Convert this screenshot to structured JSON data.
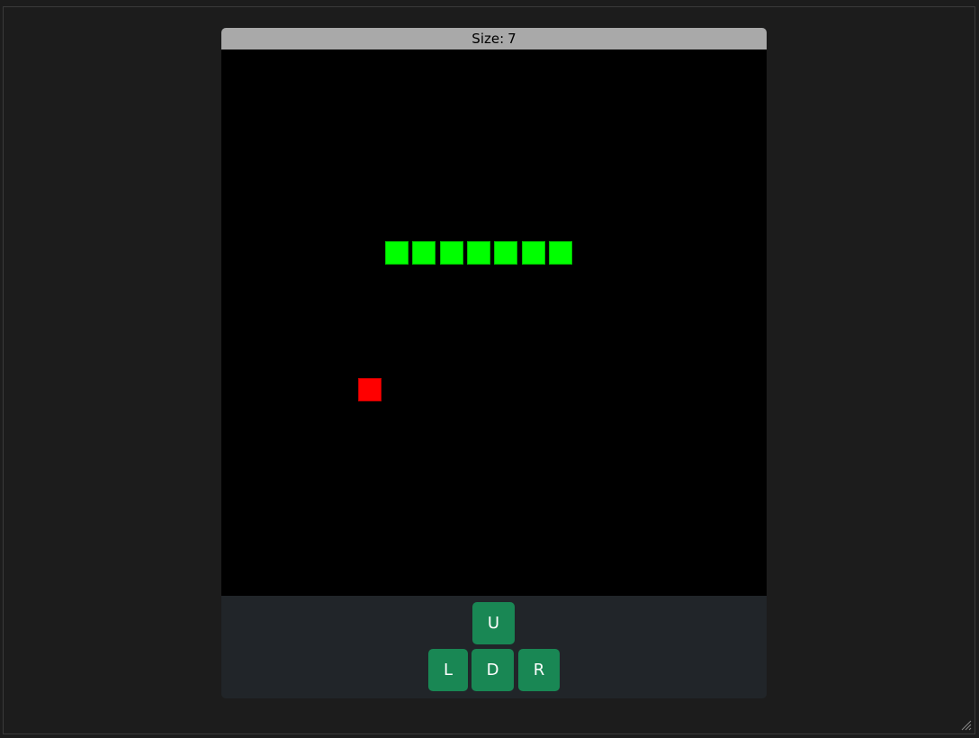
{
  "score": {
    "label": "Size:",
    "value": "7"
  },
  "board": {
    "background": "#000000",
    "snake_color": "#00ff00",
    "food_color": "#ff0000",
    "snake_cells": [
      {
        "col": 6,
        "row": 7
      },
      {
        "col": 7,
        "row": 7
      },
      {
        "col": 8,
        "row": 7
      },
      {
        "col": 9,
        "row": 7
      },
      {
        "col": 10,
        "row": 7
      },
      {
        "col": 11,
        "row": 7
      },
      {
        "col": 12,
        "row": 7
      }
    ],
    "food_cell": {
      "col": 5,
      "row": 12
    }
  },
  "controls": {
    "up": "U",
    "left": "L",
    "down": "D",
    "right": "R",
    "button_color": "#198754"
  }
}
